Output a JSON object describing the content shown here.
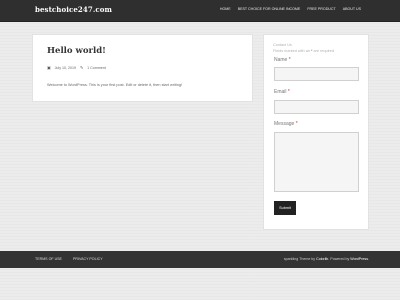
{
  "header": {
    "site_title": "bestchoice247.com",
    "nav": [
      {
        "label": "HOME"
      },
      {
        "label": "BEST CHOICE FOR ONLINE INCOME"
      },
      {
        "label": "FREE PRODUCT"
      },
      {
        "label": "ABOUT US"
      }
    ]
  },
  "post": {
    "title": "Hello world!",
    "date": "July 10, 2019",
    "comments": "1 Comment",
    "excerpt": "Welcome to WordPress. This is your first post. Edit or delete it, then start writing!",
    "icons": {
      "date": "calendar-icon",
      "comments": "comment-icon"
    }
  },
  "contact_form": {
    "heading": "Contact Us",
    "required_note_prefix": "Fields marked with an",
    "required_star": "*",
    "required_note_suffix": "are required",
    "name_label": "Name",
    "email_label": "Email",
    "message_label": "Message",
    "submit_label": "Submit"
  },
  "footer": {
    "links": [
      {
        "label": "TERMS OF USE"
      },
      {
        "label": "PRIVACY POLICY"
      }
    ],
    "credit_prefix": "sparkling Theme by",
    "credit_author": "Colorlib",
    "credit_middle": "Powered by",
    "credit_platform": "WordPress"
  },
  "colors": {
    "topbar": "#2f2f2f",
    "footer": "#333333",
    "required": "#c0392b",
    "button": "#222222"
  }
}
